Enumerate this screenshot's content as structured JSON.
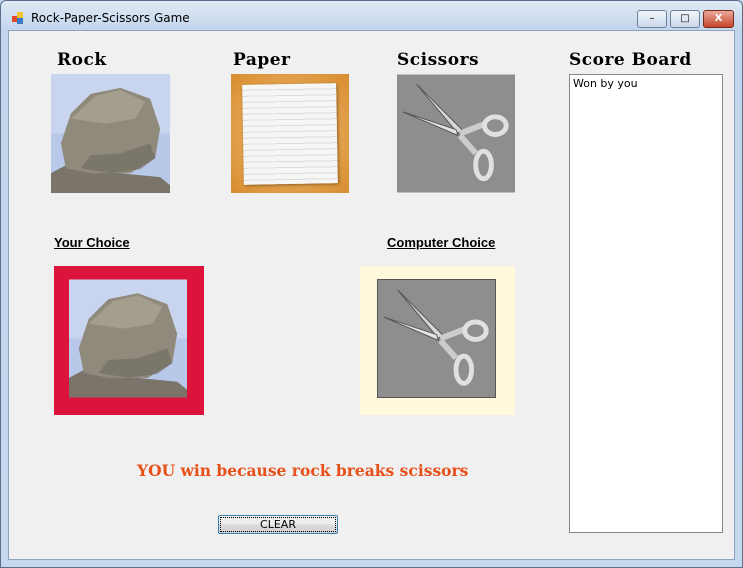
{
  "window": {
    "title": "Rock-Paper-Scissors Game",
    "minimize": "–",
    "maximize": "□",
    "close": "X"
  },
  "options": {
    "rock": "Rock",
    "paper": "Paper",
    "scissors": "Scissors"
  },
  "score_board": {
    "title": "Score Board",
    "items": [
      "Won by you"
    ]
  },
  "your_choice": {
    "label": "Your Choice",
    "choice": "rock",
    "frame_color": "#dc143c"
  },
  "computer_choice": {
    "label": "Computer Choice",
    "choice": "scissors",
    "frame_color": "#fff8dc"
  },
  "result": "YOU win because rock breaks scissors",
  "clear_button": "CLEAR"
}
